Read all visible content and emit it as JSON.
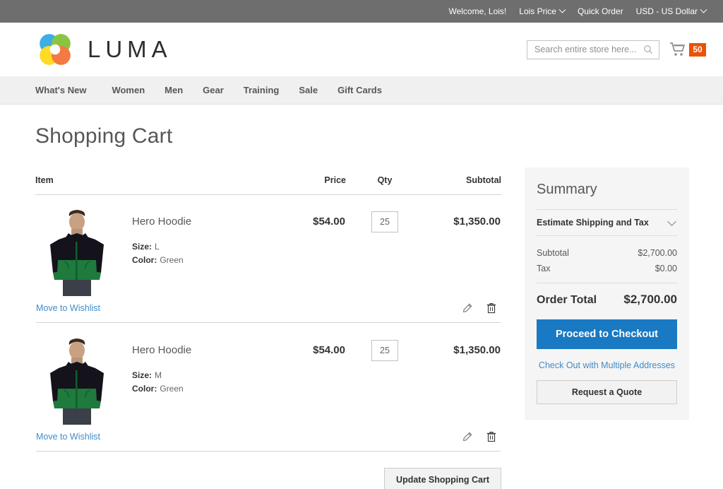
{
  "topbar": {
    "welcome": "Welcome, Lois!",
    "account": "Lois Price",
    "quick_order": "Quick Order",
    "currency": "USD - US Dollar"
  },
  "header": {
    "logo_text": "LUMA",
    "search": {
      "placeholder": "Search entire store here...",
      "value": ""
    },
    "cart_count": "50"
  },
  "nav": {
    "items": [
      {
        "label": "What's New"
      },
      {
        "label": "Women"
      },
      {
        "label": "Men"
      },
      {
        "label": "Gear"
      },
      {
        "label": "Training"
      },
      {
        "label": "Sale"
      },
      {
        "label": "Gift Cards"
      }
    ]
  },
  "page": {
    "title": "Shopping Cart"
  },
  "cart": {
    "columns": {
      "item": "Item",
      "price": "Price",
      "qty": "Qty",
      "subtotal": "Subtotal"
    },
    "rows": [
      {
        "name": "Hero Hoodie",
        "size_label": "Size:",
        "size_value": "L",
        "color_label": "Color:",
        "color_value": "Green",
        "price": "$54.00",
        "qty": "25",
        "subtotal": "$1,350.00",
        "wishlist_label": "Move to Wishlist"
      },
      {
        "name": "Hero Hoodie",
        "size_label": "Size:",
        "size_value": "M",
        "color_label": "Color:",
        "color_value": "Green",
        "price": "$54.00",
        "qty": "25",
        "subtotal": "$1,350.00",
        "wishlist_label": "Move to Wishlist"
      }
    ],
    "update_button": "Update Shopping Cart"
  },
  "summary": {
    "heading": "Summary",
    "estimate_label": "Estimate Shipping and Tax",
    "subtotal_label": "Subtotal",
    "subtotal_value": "$2,700.00",
    "tax_label": "Tax",
    "tax_value": "$0.00",
    "order_total_label": "Order Total",
    "order_total_value": "$2,700.00",
    "checkout_button": "Proceed to Checkout",
    "multi_address_link": "Check Out with Multiple Addresses",
    "quote_button": "Request a Quote"
  },
  "colors": {
    "topbar_bg": "#6e6e6e",
    "nav_bg": "#f0f0f0",
    "accent_orange": "#eb5202",
    "accent_blue": "#1979c3",
    "link_blue": "#3f8bc9",
    "summary_bg": "#f5f5f5"
  }
}
